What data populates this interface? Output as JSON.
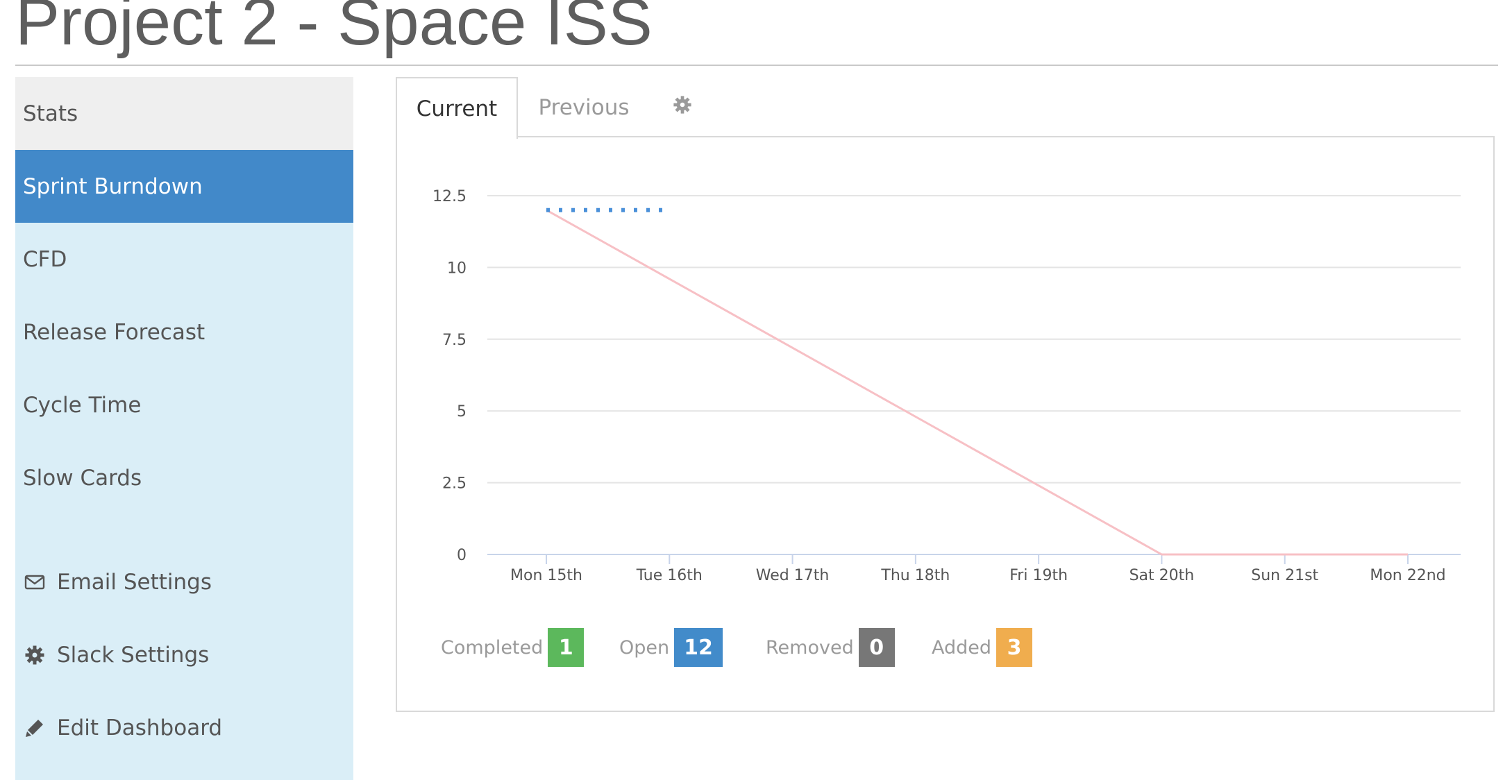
{
  "page": {
    "title": "Project 2 - Space ISS"
  },
  "sidebar": {
    "items": [
      {
        "label": "Stats"
      },
      {
        "label": "Sprint Burndown"
      },
      {
        "label": "CFD"
      },
      {
        "label": "Release Forecast"
      },
      {
        "label": "Cycle Time"
      },
      {
        "label": "Slow Cards"
      }
    ],
    "settings": [
      {
        "label": "Email Settings",
        "icon": "envelope-icon"
      },
      {
        "label": "Slack Settings",
        "icon": "gear-icon"
      },
      {
        "label": "Edit Dashboard",
        "icon": "pencil-icon"
      }
    ]
  },
  "tabs": [
    {
      "label": "Current"
    },
    {
      "label": "Previous"
    },
    {
      "icon": "gear-icon"
    }
  ],
  "colors": {
    "active": "#4289c9",
    "sidebar_bg": "#daeef7",
    "ideal_line": "#f7c0c5",
    "actual_line": "#4a90d9",
    "completed": "#5cb85c",
    "open": "#428bca",
    "removed": "#777777",
    "added": "#f0ad4e"
  },
  "chart_data": {
    "type": "line",
    "categories": [
      "Mon 15th",
      "Tue 16th",
      "Wed 17th",
      "Thu 18th",
      "Fri 19th",
      "Sat 20th",
      "Sun 21st",
      "Mon 22nd"
    ],
    "y_ticks": [
      "0",
      "2.5",
      "5",
      "7.5",
      "10",
      "12.5"
    ],
    "ylim": [
      0,
      12.5
    ],
    "grid": true,
    "series": [
      {
        "style": "solid",
        "color": "#f7c0c5",
        "values": [
          12,
          9.6,
          7.2,
          4.8,
          2.4,
          0,
          0,
          0
        ]
      },
      {
        "style": "dotted",
        "color": "#4a90d9",
        "values": [
          12,
          12,
          null,
          null,
          null,
          null,
          null,
          null
        ]
      }
    ]
  },
  "legend": [
    {
      "label": "Completed",
      "value": "1",
      "color": "#5cb85c"
    },
    {
      "label": "Open",
      "value": "12",
      "color": "#428bca"
    },
    {
      "label": "Removed",
      "value": "0",
      "color": "#777777"
    },
    {
      "label": "Added",
      "value": "3",
      "color": "#f0ad4e"
    }
  ]
}
